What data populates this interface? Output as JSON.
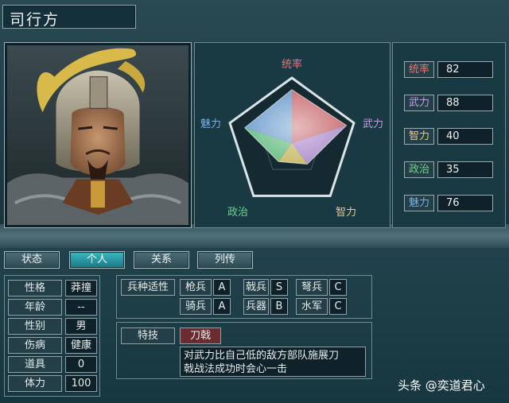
{
  "character": {
    "name": "司行方"
  },
  "colors": {
    "tongshuai": "#e8767a",
    "wuli": "#c79be6",
    "zhili": "#e6d06c",
    "zhengzhi": "#6fd58c",
    "meili": "#7ab0e8",
    "tab_active": "#2fa6b0"
  },
  "radar": {
    "labels": [
      "统率",
      "武力",
      "智力",
      "政治",
      "魅力"
    ],
    "max": 100
  },
  "stats": [
    {
      "label": "统率",
      "value": 82
    },
    {
      "label": "武力",
      "value": 88
    },
    {
      "label": "智力",
      "value": 40
    },
    {
      "label": "政治",
      "value": 35
    },
    {
      "label": "魅力",
      "value": 76
    }
  ],
  "tabs": [
    {
      "label": "状态",
      "active": false
    },
    {
      "label": "个人",
      "active": true
    },
    {
      "label": "关系",
      "active": false
    },
    {
      "label": "列传",
      "active": false
    }
  ],
  "personal": [
    {
      "label": "性格",
      "value": "莽撞"
    },
    {
      "label": "年龄",
      "value": "--"
    },
    {
      "label": "性别",
      "value": "男"
    },
    {
      "label": "伤病",
      "value": "健康"
    },
    {
      "label": "道具",
      "value": "0"
    },
    {
      "label": "体力",
      "value": "100"
    }
  ],
  "aptitude": {
    "title": "兵种适性",
    "row1": [
      {
        "unit": "枪兵",
        "grade": "A"
      },
      {
        "unit": "戟兵",
        "grade": "S"
      },
      {
        "unit": "弩兵",
        "grade": "C"
      }
    ],
    "row2": [
      {
        "unit": "骑兵",
        "grade": "A"
      },
      {
        "unit": "兵器",
        "grade": "B"
      },
      {
        "unit": "水军",
        "grade": "C"
      }
    ]
  },
  "skill": {
    "title": "特技",
    "name": "刀戟",
    "description_line1": "对武力比自己低的敌方部队施展刀",
    "description_line2": "戟战法成功时会心一击"
  },
  "watermark": "头条 @奕道君心"
}
